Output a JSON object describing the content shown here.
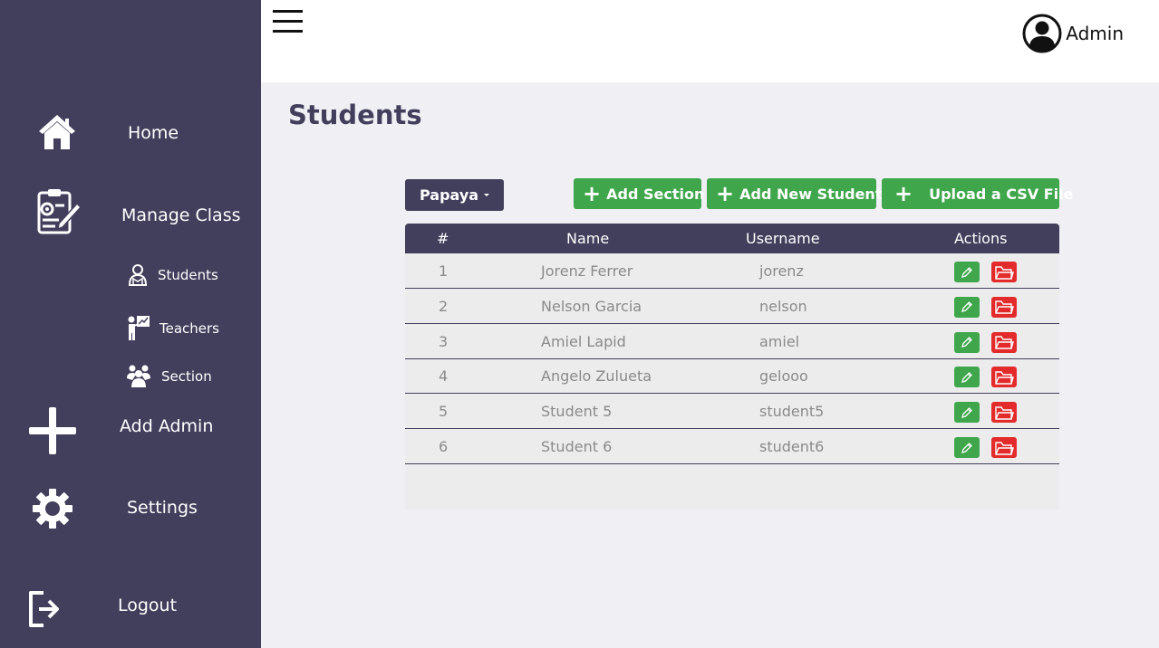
{
  "sidebar": {
    "items": [
      {
        "label": "Home",
        "icon": "home-icon"
      },
      {
        "label": "Manage Class",
        "icon": "clipboard-gear-icon"
      },
      {
        "label": "Add Admin",
        "icon": "plus-icon"
      },
      {
        "label": "Settings",
        "icon": "gear-icon"
      },
      {
        "label": "Logout",
        "icon": "logout-icon"
      }
    ],
    "subitems": [
      {
        "label": "Students",
        "icon": "student-icon"
      },
      {
        "label": "Teachers",
        "icon": "teacher-icon"
      },
      {
        "label": "Section",
        "icon": "group-icon"
      }
    ]
  },
  "header": {
    "user_label": "Admin",
    "menu_icon": "hamburger-icon",
    "user_icon": "user-circle-icon"
  },
  "main": {
    "title": "Students",
    "section_select": "Papaya",
    "buttons": {
      "add_section": "Add Section",
      "add_student": "Add New Student",
      "upload_csv": "Upload a CSV File"
    },
    "table": {
      "columns": [
        "#",
        "Name",
        "Username",
        "Actions"
      ],
      "rows": [
        {
          "num": "1",
          "name": "Jorenz Ferrer",
          "username": "jorenz"
        },
        {
          "num": "2",
          "name": "Nelson Garcia",
          "username": "nelson"
        },
        {
          "num": "3",
          "name": "Amiel Lapid",
          "username": "amiel"
        },
        {
          "num": "4",
          "name": "Angelo Zulueta",
          "username": "gelooo"
        },
        {
          "num": "5",
          "name": "Student 5",
          "username": "student5"
        },
        {
          "num": "6",
          "name": "Student 6",
          "username": "student6"
        }
      ]
    }
  },
  "colors": {
    "sidebar": "#423f5c",
    "accent_green": "#3fa64b",
    "danger_red": "#e32b2b",
    "background": "#efeff4"
  }
}
